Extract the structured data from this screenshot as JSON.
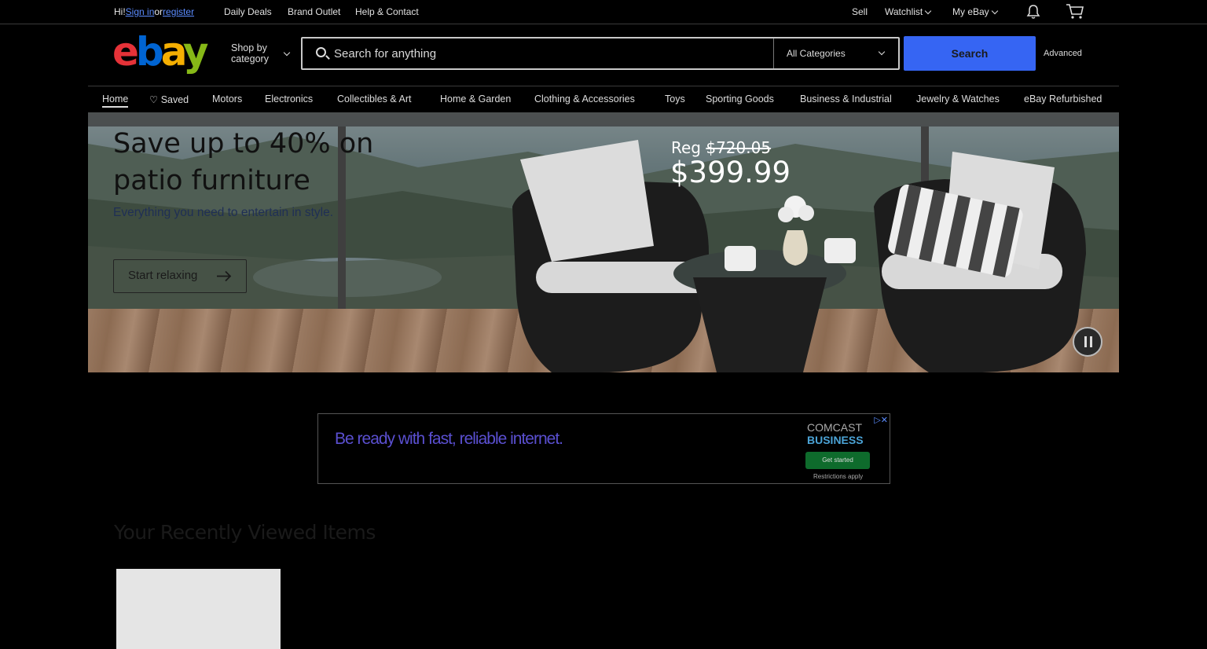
{
  "topbar": {
    "greeting_prefix": "Hi! ",
    "sign_in": "Sign in",
    "or": " or ",
    "register": "register",
    "links": [
      "Daily Deals",
      "Brand Outlet",
      "Help & Contact"
    ],
    "sell": "Sell",
    "watchlist": "Watchlist",
    "my_ebay": "My eBay",
    "notification_icon": "bell-icon",
    "cart_icon": "cart-icon"
  },
  "header": {
    "logo": [
      "e",
      "b",
      "a",
      "y"
    ],
    "shop_by_line1": "Shop by",
    "shop_by_line2": "category",
    "search_placeholder": "Search for anything",
    "category_selected": "All Categories",
    "search_button": "Search",
    "advanced": "Advanced"
  },
  "nav": {
    "items": [
      "Home",
      "Saved",
      "Motors",
      "Electronics",
      "Collectibles & Art",
      "Home & Garden",
      "Clothing & Accessories",
      "Toys",
      "Sporting Goods",
      "Business & Industrial",
      "Jewelry & Watches",
      "eBay Refurbished"
    ]
  },
  "hero": {
    "title": "Save up to 40% on patio furniture",
    "subtitle": "Everything you need to entertain in style.",
    "cta": "Start relaxing",
    "reg_label": "Reg ",
    "reg_price": "$720.05",
    "sale_price": "$399.99",
    "pause_icon": "pause-icon"
  },
  "ad": {
    "headline": "Be ready with fast, reliable internet.",
    "brand_line1": "COMCAST",
    "brand_line2": "BUSINESS",
    "cta": "Get started",
    "fine_print": "Restrictions apply"
  },
  "recently_viewed": {
    "title": "Your Recently Viewed Items"
  }
}
